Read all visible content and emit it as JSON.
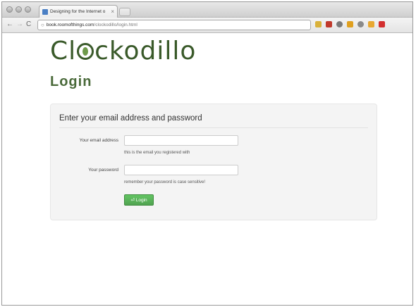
{
  "browser": {
    "tab_title": "Designing for the Internet o",
    "tab_close": "×",
    "url_host": "book.roomofthings.com",
    "url_path": "/clockodillo/login.html",
    "back_glyph": "←",
    "forward_glyph": "→",
    "reload_glyph": "C",
    "extension_colors": [
      "#d9b13a",
      "#c0392b",
      "#7a7a7a",
      "#e0a020",
      "#8a8a8a",
      "#e8a832",
      "#d32f2f"
    ]
  },
  "site": {
    "logo_prefix": "Cl",
    "logo_suffix": "ckodillo",
    "page_title": "Login"
  },
  "form": {
    "heading": "Enter your email address and password",
    "email_label": "Your email address",
    "email_value": "",
    "email_help": "this is the email you registered with",
    "password_label": "Your password",
    "password_value": "",
    "password_help": "remember your password is case sensitive!",
    "submit_icon": "⏎",
    "submit_label": "Login"
  },
  "colors": {
    "brand_green": "#3a5a2a",
    "button_green": "#51a351"
  }
}
